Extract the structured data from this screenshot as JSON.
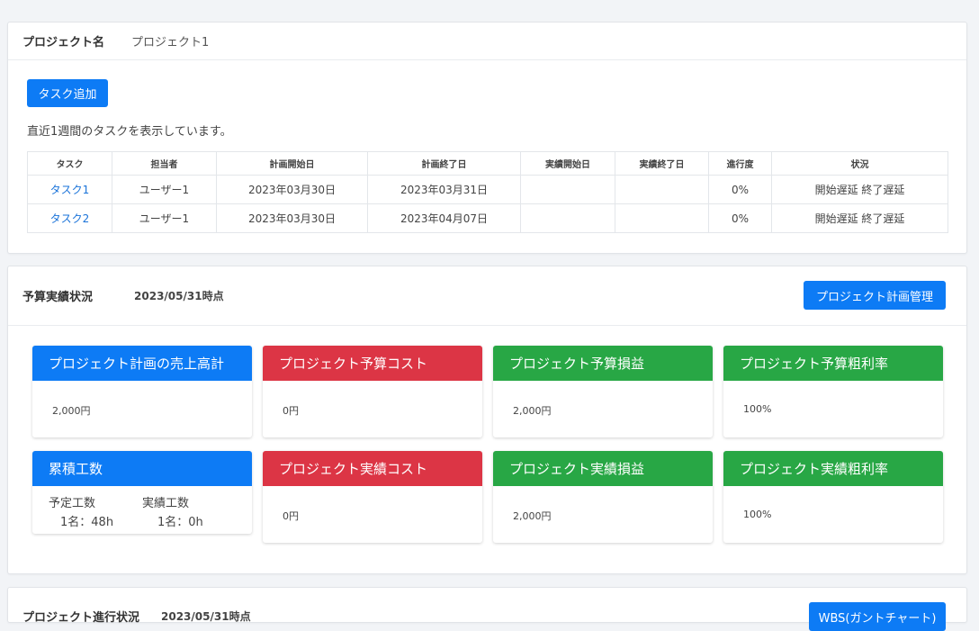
{
  "project": {
    "name_label": "プロジェクト名",
    "name_value": "プロジェクト1",
    "add_task_label": "タスク追加",
    "notice": "直近1週間のタスクを表示しています。",
    "columns": [
      "タスク",
      "担当者",
      "計画開始日",
      "計画終了日",
      "実績開始日",
      "実績終了日",
      "進行度",
      "状況"
    ],
    "rows": [
      {
        "task": "タスク1",
        "assignee": "ユーザー1",
        "plan_start": "2023年03月30日",
        "plan_end": "2023年03月31日",
        "actual_start": "",
        "actual_end": "",
        "progress": "0%",
        "status": "開始遅延 終了遅延"
      },
      {
        "task": "タスク2",
        "assignee": "ユーザー1",
        "plan_start": "2023年03月30日",
        "plan_end": "2023年04月07日",
        "actual_start": "",
        "actual_end": "",
        "progress": "0%",
        "status": "開始遅延 終了遅延"
      }
    ]
  },
  "budget": {
    "title": "予算実績状況",
    "as_of": "2023/05/31時点",
    "manage_button": "プロジェクト計画管理",
    "cards": [
      {
        "title": "プロジェクト計画の売上高計",
        "value": "2,000円",
        "color": "#0d7bf5"
      },
      {
        "title": "プロジェクト予算コスト",
        "value": "0円",
        "color": "#dc3545"
      },
      {
        "title": "プロジェクト予算損益",
        "value": "2,000円",
        "color": "#28a745"
      },
      {
        "title": "プロジェクト予算粗利率",
        "value": "100%",
        "color": "#28a745"
      },
      {
        "title": "累積工数",
        "color": "#0d7bf5",
        "planned_label": "予定工数",
        "actual_label": "実績工数",
        "planned_value": "1名：48h",
        "actual_value": "1名：0h"
      },
      {
        "title": "プロジェクト実績コスト",
        "value": "0円",
        "color": "#dc3545"
      },
      {
        "title": "プロジェクト実績損益",
        "value": "2,000円",
        "color": "#28a745"
      },
      {
        "title": "プロジェクト実績粗利率",
        "value": "100%",
        "color": "#28a745"
      }
    ]
  },
  "progress_section": {
    "title": "プロジェクト進行状況",
    "as_of": "2023/05/31時点",
    "wbs_button": "WBS(ガントチャート)"
  }
}
